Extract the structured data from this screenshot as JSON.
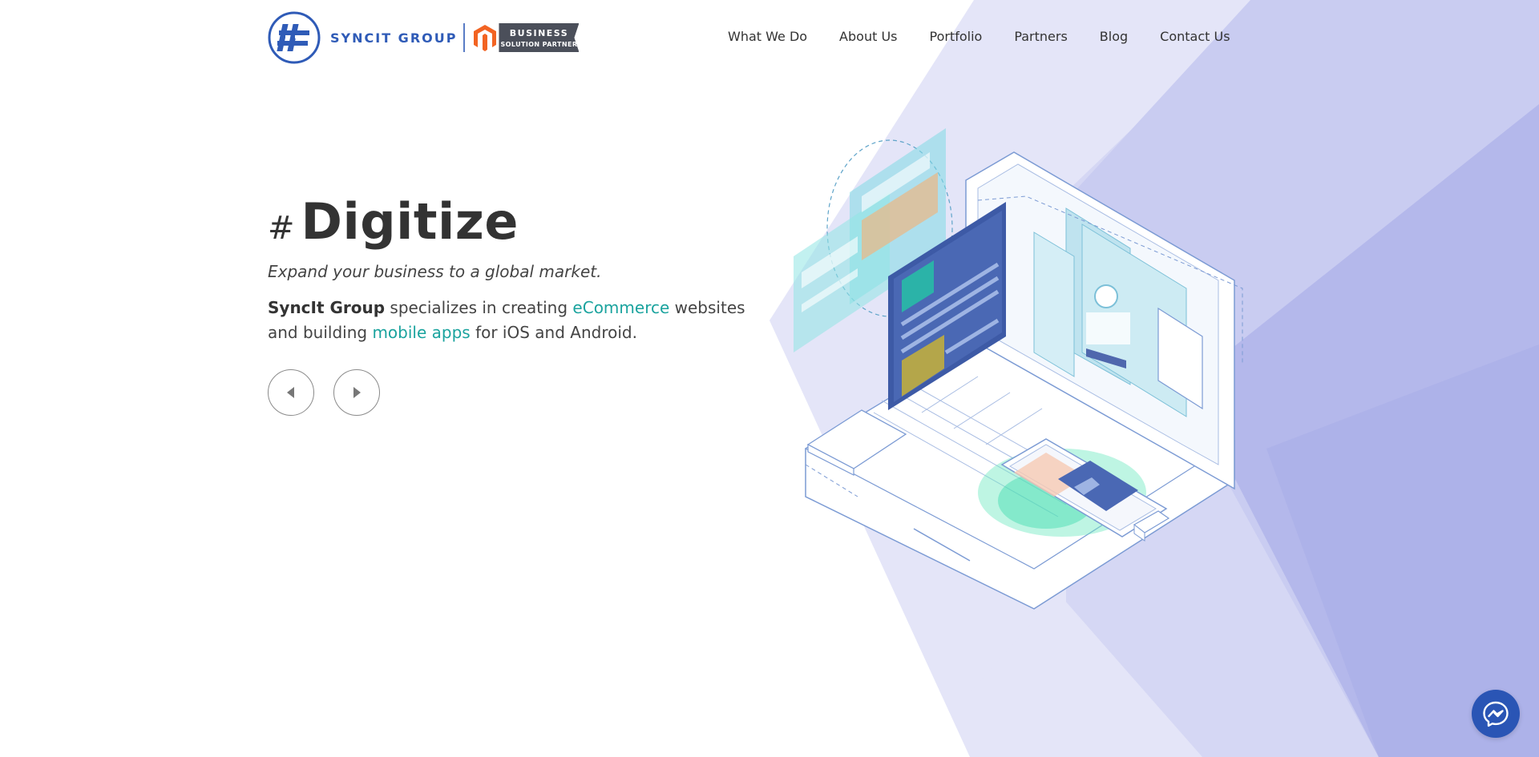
{
  "header": {
    "logo_text": "SYNCIT GROUP",
    "badge_top": "BUSINESS",
    "badge_bottom": "SOLUTION PARTNER"
  },
  "nav": {
    "items": [
      {
        "label": "What We Do"
      },
      {
        "label": "About Us"
      },
      {
        "label": "Portfolio"
      },
      {
        "label": "Partners"
      },
      {
        "label": "Blog"
      },
      {
        "label": "Contact Us"
      }
    ]
  },
  "hero": {
    "hash": "#",
    "title": "Digitize",
    "subtitle": "Expand your business to a global market.",
    "desc_brand": "SyncIt Group",
    "desc_part1": " specializes in creating ",
    "desc_link1": "eCommerce",
    "desc_part2": " websites and building ",
    "desc_link2": "mobile apps",
    "desc_part3": " for iOS and Android."
  },
  "controls": {
    "prev_icon": "caret-left-icon",
    "next_icon": "caret-right-icon"
  },
  "messenger": {
    "icon": "messenger-icon"
  },
  "colors": {
    "brand_blue": "#2f5bb7",
    "accent_teal": "#1aa39e",
    "text_dark": "#333333",
    "bg_lavender": "#c5c8f0",
    "magento_orange": "#f26322"
  }
}
